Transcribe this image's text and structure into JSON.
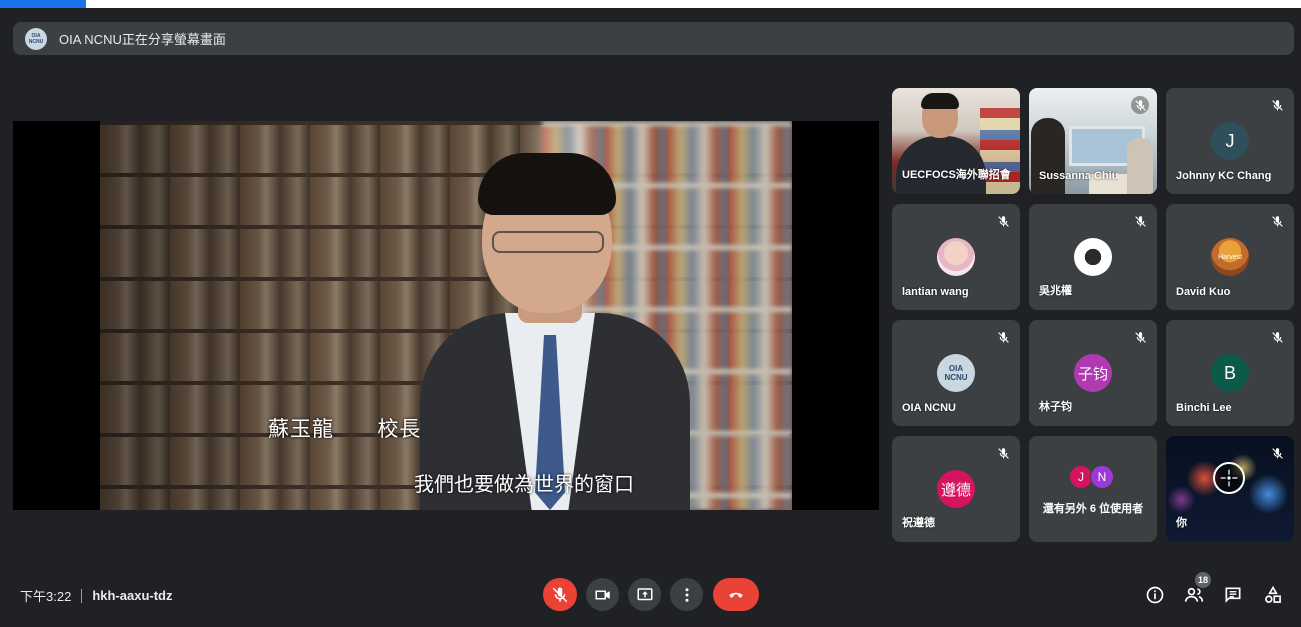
{
  "banner": {
    "logo_text": "OIA NCNU",
    "text": "OIA NCNU正在分享螢幕畫面"
  },
  "presentation": {
    "caption_name": "蘇玉龍  校長",
    "caption_subtitle": "我們也要做為世界的窗口"
  },
  "participants": [
    {
      "name": "UECFOCS海外聯招會",
      "type": "camera",
      "muted": false
    },
    {
      "name": "Sussanna Chiu",
      "type": "camera",
      "muted": true
    },
    {
      "name": "Johnny KC Chang",
      "initial": "J",
      "avatar_color": "#2f4f5a",
      "muted": true
    },
    {
      "name": "lantian wang",
      "type": "photo",
      "muted": true
    },
    {
      "name": "吳兆權",
      "type": "photo",
      "muted": true
    },
    {
      "name": "David Kuo",
      "type": "photo",
      "avatar_text": "Harvest",
      "muted": true
    },
    {
      "name": "OIA NCNU",
      "type": "logo",
      "avatar_text": "OIA NCNU",
      "muted": true
    },
    {
      "name": "林子钧",
      "initial": "子钧",
      "avatar_color": "#b03ab0",
      "muted": true
    },
    {
      "name": "Binchi Lee",
      "initial": "B",
      "avatar_color": "#0b5a4a",
      "muted": true
    },
    {
      "name": "祝遵德",
      "initial": "遵德",
      "avatar_color": "#d6135f",
      "muted": true
    },
    {
      "name": "還有另外 6 位使用者",
      "type": "others",
      "initials": [
        "J",
        "N"
      ],
      "colors": [
        "#d6135f",
        "#9b3ad6"
      ]
    },
    {
      "name": "你",
      "type": "self",
      "muted": true
    }
  ],
  "footer": {
    "time": "下午3:22",
    "meeting_code": "hkh-aaxu-tdz",
    "participant_count": "18"
  },
  "controls": {
    "mic": "mic-off-icon",
    "camera": "camera-icon",
    "present": "present-icon",
    "more": "more-vert-icon",
    "leave": "call-end-icon"
  },
  "colors": {
    "background": "#202124",
    "tile": "#3c4043",
    "danger": "#ea4335",
    "accent": "#1a73e8"
  }
}
